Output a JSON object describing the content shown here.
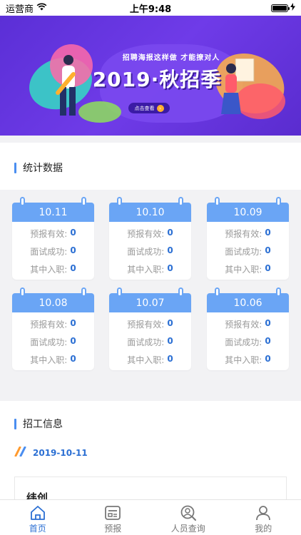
{
  "status_bar": {
    "carrier": "运营商",
    "time": "上午9:48",
    "battery_level": 1.0
  },
  "banner": {
    "subtitle": "招聘海报这样做 才能撩对人",
    "title": "2019·秋招季",
    "button_label": "点击查看",
    "pagination": {
      "count": 3,
      "active_index": 0
    }
  },
  "stats": {
    "section_title": "统计数据",
    "cards": [
      {
        "date": "10.11",
        "rows": [
          {
            "label": "预报有效:",
            "value": "0"
          },
          {
            "label": "面试成功:",
            "value": "0"
          },
          {
            "label": "其中入职:",
            "value": "0"
          }
        ]
      },
      {
        "date": "10.10",
        "rows": [
          {
            "label": "预报有效:",
            "value": "0"
          },
          {
            "label": "面试成功:",
            "value": "0"
          },
          {
            "label": "其中入职:",
            "value": "0"
          }
        ]
      },
      {
        "date": "10.09",
        "rows": [
          {
            "label": "预报有效:",
            "value": "0"
          },
          {
            "label": "面试成功:",
            "value": "0"
          },
          {
            "label": "其中入职:",
            "value": "0"
          }
        ]
      },
      {
        "date": "10.08",
        "rows": [
          {
            "label": "预报有效:",
            "value": "0"
          },
          {
            "label": "面试成功:",
            "value": "0"
          },
          {
            "label": "其中入职:",
            "value": "0"
          }
        ]
      },
      {
        "date": "10.07",
        "rows": [
          {
            "label": "预报有效:",
            "value": "0"
          },
          {
            "label": "面试成功:",
            "value": "0"
          },
          {
            "label": "其中入职:",
            "value": "0"
          }
        ]
      },
      {
        "date": "10.06",
        "rows": [
          {
            "label": "预报有效:",
            "value": "0"
          },
          {
            "label": "面试成功:",
            "value": "0"
          },
          {
            "label": "其中入职:",
            "value": "0"
          }
        ]
      }
    ]
  },
  "recruit": {
    "section_title": "招工信息",
    "date": "2019-10-11",
    "job_name": "纬创"
  },
  "tabbar": {
    "active": "home",
    "tabs": [
      {
        "id": "home",
        "label": "首页",
        "icon": "home-icon"
      },
      {
        "id": "report",
        "label": "预报",
        "icon": "report-icon"
      },
      {
        "id": "search",
        "label": "人员查询",
        "icon": "person-search-icon"
      },
      {
        "id": "mine",
        "label": "我的",
        "icon": "user-icon"
      }
    ]
  },
  "colors": {
    "accent": "#2b6fd3",
    "card_header": "#6aa5f5",
    "banner_bg": "#5b2fd6"
  }
}
